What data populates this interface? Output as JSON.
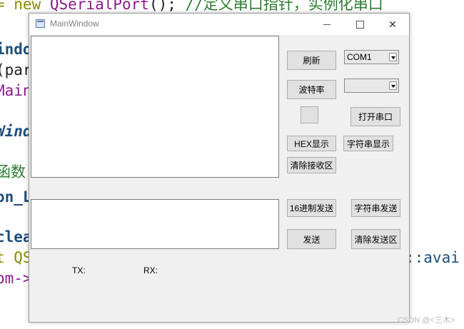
{
  "code": {
    "line1_kw": "= new ",
    "line1_cls": "QSerialPort",
    "line1_rest": "(); ",
    "line1_comment": "//定义串口指针，实例化串口",
    "line2": "indo",
    "line3": "(par",
    "line4": "Main",
    "line5": "Wind",
    "line6": "函数",
    "line7": "on_L",
    "line8": "clea",
    "line9_left": "t QS",
    "line9_right": "::avai",
    "line10": "om->"
  },
  "window": {
    "title": "MainWindow",
    "controls": {
      "minimize": "—",
      "maximize": "☐",
      "close": "✕"
    }
  },
  "buttons": {
    "refresh": "刷新",
    "baud": "波特率",
    "blank": "",
    "open_port": "打开串口",
    "hex_display": "HEX显示",
    "string_display": "字符串显示",
    "clear_receive": "清除接收区",
    "hex_send": "16进制发送",
    "string_send": "字符串发送",
    "send": "发送",
    "clear_send": "清除发送区"
  },
  "combos": {
    "port": "COM1",
    "baud": ""
  },
  "labels": {
    "tx": "TX:",
    "rx": "RX:"
  },
  "watermark": "CSDN @<三木>"
}
